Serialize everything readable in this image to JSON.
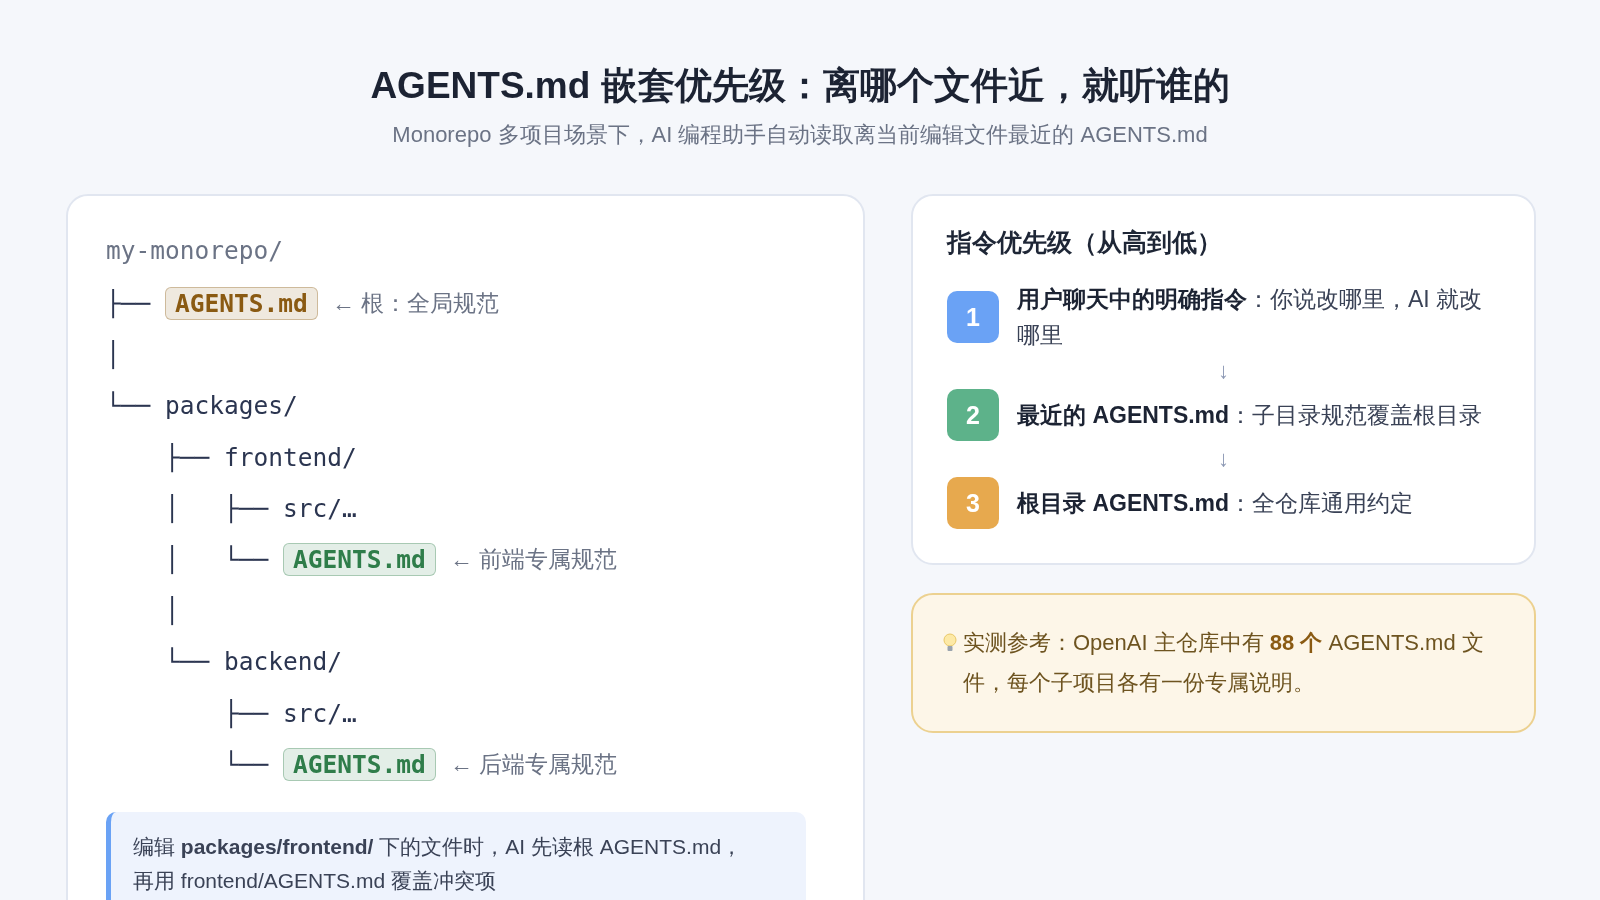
{
  "title": "AGENTS.md 嵌套优先级：离哪个文件近，就听谁的",
  "subtitle": "Monorepo 多项目场景下，AI 编程助手自动读取离当前编辑文件最近的 AGENTS.md",
  "tree": {
    "root": "my-monorepo/",
    "lines": [
      {
        "prefix": "├── ",
        "kind": "file",
        "name": "AGENTS.md",
        "color": "#8a5a12",
        "note": "← 根：全局规范"
      },
      {
        "prefix": "│",
        "kind": "blank"
      },
      {
        "prefix": "└── ",
        "kind": "dir",
        "name": "packages/"
      },
      {
        "prefix": "    ├── ",
        "kind": "dir",
        "name": "frontend/"
      },
      {
        "prefix": "    │   ├── ",
        "kind": "dir",
        "name": "src/…"
      },
      {
        "prefix": "    │   └── ",
        "kind": "file",
        "name": "AGENTS.md",
        "color": "#2f7d4a",
        "note": "← 前端专属规范"
      },
      {
        "prefix": "    │",
        "kind": "blank"
      },
      {
        "prefix": "    └── ",
        "kind": "dir",
        "name": "backend/"
      },
      {
        "prefix": "        ├── ",
        "kind": "dir",
        "name": "src/…"
      },
      {
        "prefix": "        └── ",
        "kind": "file",
        "name": "AGENTS.md",
        "color": "#2f7d4a",
        "note": "← 后端专属规范"
      }
    ]
  },
  "callout": [
    "编辑 **packages/frontend/** 下的文件时，AI 先读根 AGENTS.md，",
    "再用 frontend/AGENTS.md 覆盖冲突项"
  ],
  "priority": {
    "title": "指令优先级（从高到低）",
    "steps": [
      {
        "number": "1",
        "color": "#6aa2f5",
        "text": "**用户聊天中的明确指令**：你说改哪里，AI 就改哪里"
      },
      {
        "arrow": "↓",
        "number": "2",
        "color": "#5db28a",
        "text": "**最近的 AGENTS.md**：子目录规范覆盖根目录"
      },
      {
        "arrow": "↓",
        "number": "3",
        "color": "#e7a94e",
        "text": "**根目录 AGENTS.md**：全仓库通用约定"
      }
    ]
  },
  "note": "实测参考：OpenAI 主仓库中有 **88 个** AGENTS.md 文件，每个子项目各有一份专属说明。"
}
